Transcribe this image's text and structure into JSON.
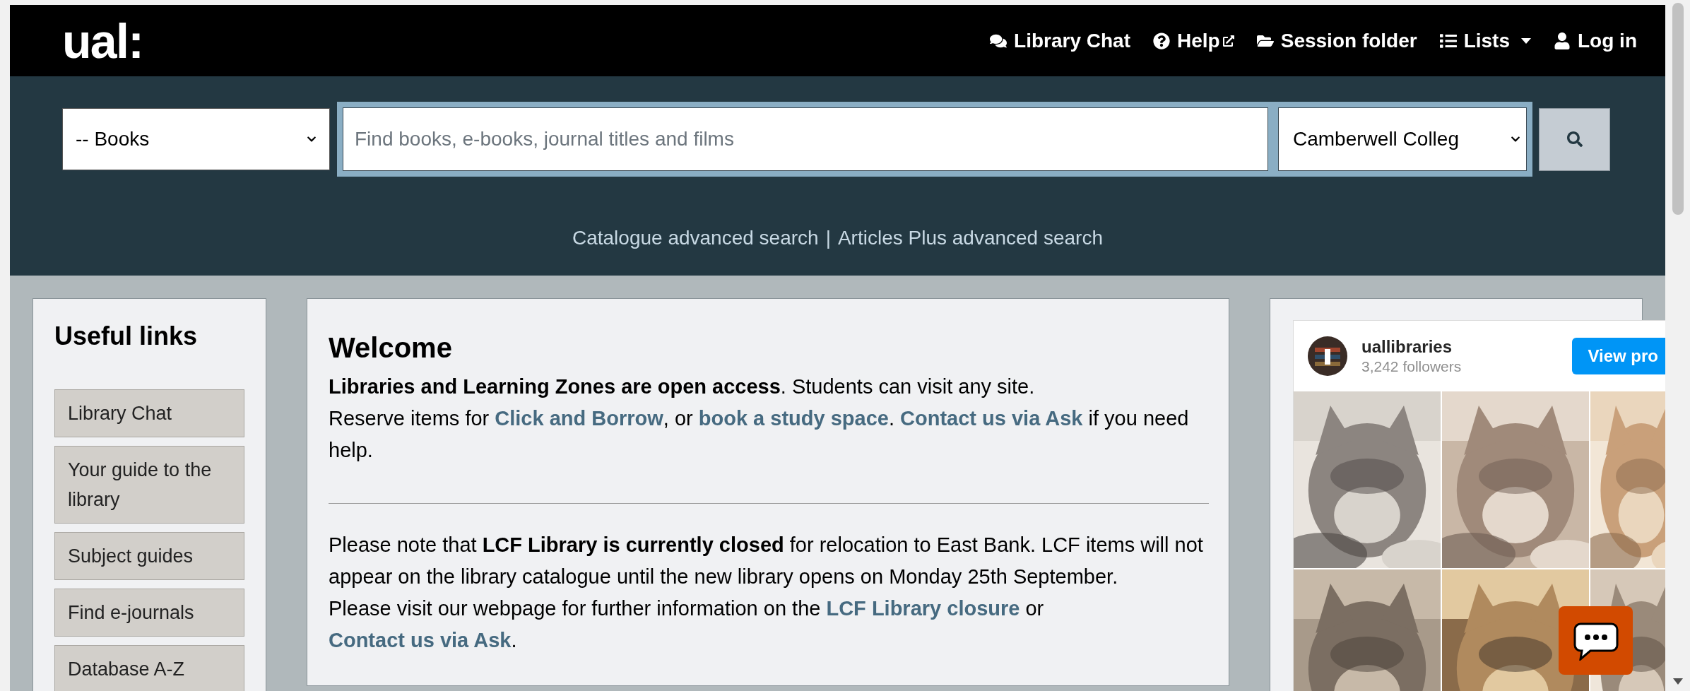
{
  "header": {
    "logo": "ual:",
    "nav": [
      {
        "label": "Library Chat",
        "external": false,
        "dropdown": false
      },
      {
        "label": "Help",
        "external": true,
        "dropdown": false
      },
      {
        "label": "Session folder",
        "external": false,
        "dropdown": false
      },
      {
        "label": "Lists",
        "external": false,
        "dropdown": true
      },
      {
        "label": "Log in",
        "external": false,
        "dropdown": false
      }
    ]
  },
  "search": {
    "type_select": "-- Books",
    "placeholder": "Find books, e-books, journal titles and films",
    "campus_select": "Camberwell Colleg"
  },
  "advanced_links": {
    "items": [
      "Catalogue advanced search",
      "Articles Plus advanced search"
    ],
    "separator": "|"
  },
  "useful_links": {
    "title": "Useful links",
    "items": [
      "Library Chat",
      "Your guide to the library",
      "Subject guides",
      "Find e-journals",
      "Database A-Z"
    ]
  },
  "welcome": {
    "title": "Welcome",
    "paragraphs": [
      [
        [
          {
            "kind": "bold",
            "text": "Libraries and Learning Zones are open access"
          },
          {
            "kind": "text",
            "text": ". Students can visit any site."
          }
        ],
        [
          {
            "kind": "text",
            "text": "Reserve items for "
          },
          {
            "kind": "link",
            "text": "Click and Borrow"
          },
          {
            "kind": "text",
            "text": ", or "
          },
          {
            "kind": "link",
            "text": "book a study space"
          },
          {
            "kind": "text",
            "text": ". "
          },
          {
            "kind": "link",
            "text": "Contact us via Ask"
          },
          {
            "kind": "text",
            "text": " if you need help."
          }
        ]
      ],
      [
        [
          {
            "kind": "text",
            "text": "Please note that "
          },
          {
            "kind": "bold",
            "text": "LCF Library is currently closed"
          },
          {
            "kind": "text",
            "text": " for relocation to East Bank. LCF items will not appear on the library catalogue until the new library opens on Monday 25th September."
          }
        ],
        [
          {
            "kind": "text",
            "text": "Please visit our webpage for further information on the "
          },
          {
            "kind": "link",
            "text": "LCF Library closure"
          },
          {
            "kind": "text",
            "text": " or "
          },
          {
            "kind": "link",
            "text": "Contact us via Ask"
          },
          {
            "kind": "text",
            "text": "."
          }
        ]
      ]
    ]
  },
  "instagram": {
    "username": "uallibraries",
    "followers": "3,242 followers",
    "button": "View pro"
  }
}
